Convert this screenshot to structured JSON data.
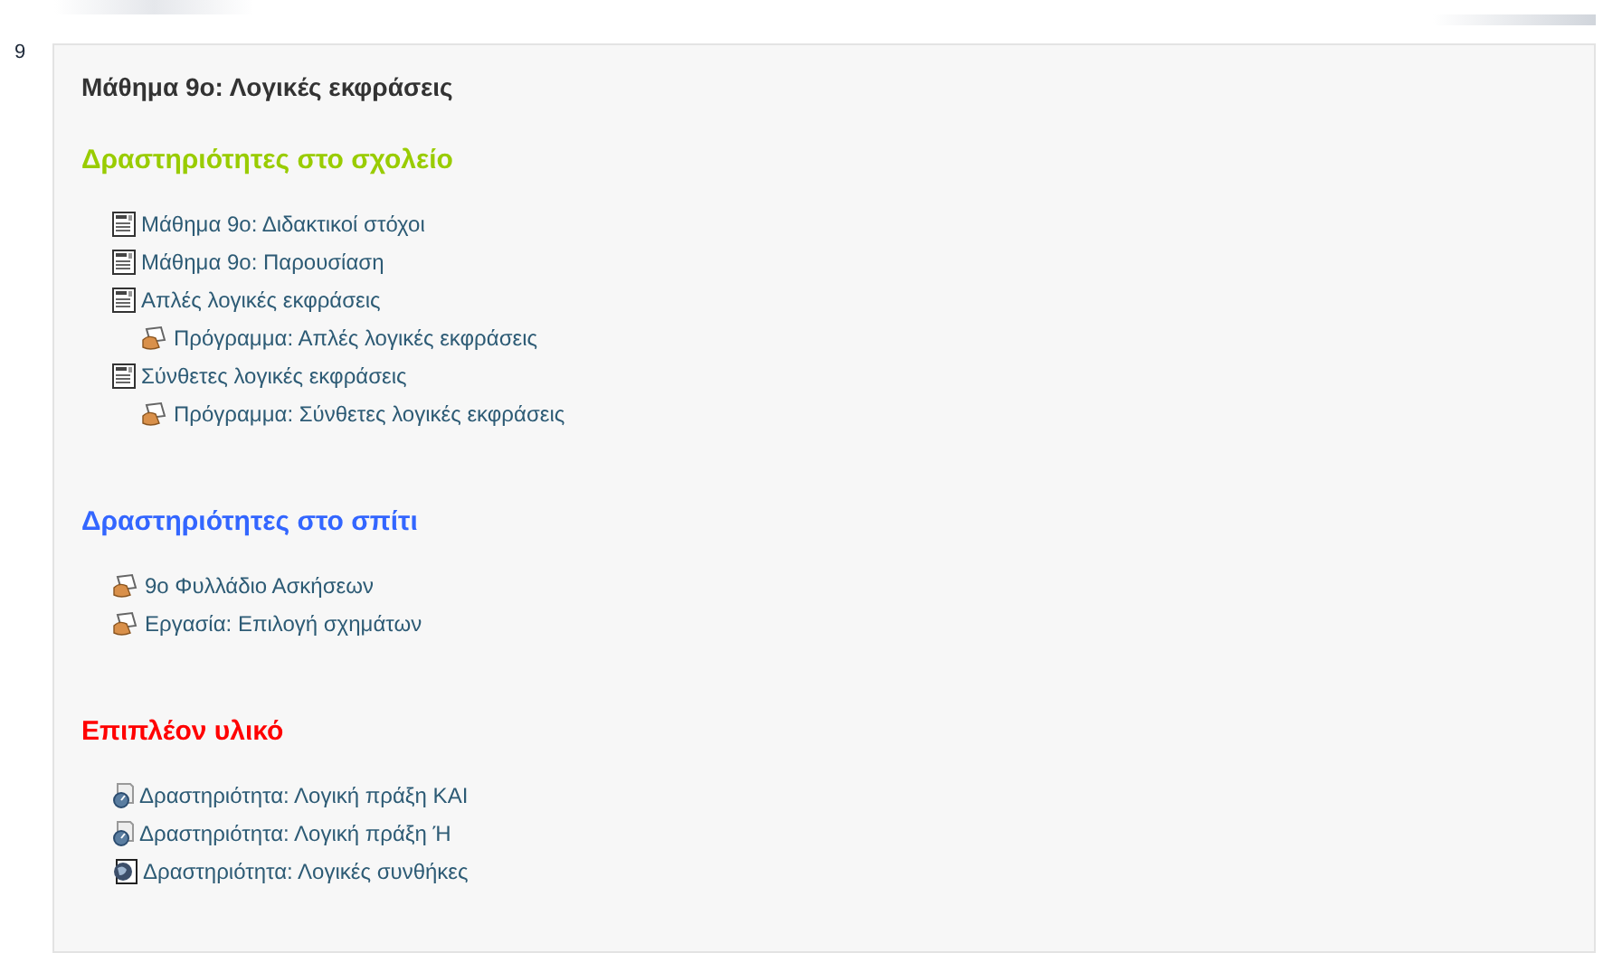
{
  "section_number": "9",
  "title": "Μάθημα 9ο: Λογικές εκφράσεις",
  "groups": [
    {
      "heading": "Δραστηριότητες στο σχολείο",
      "color": "#99cc00",
      "items": [
        {
          "kind": "page",
          "label": "Μάθημα 9ο: Διδακτικοί στόχοι"
        },
        {
          "kind": "page",
          "label": "Μάθημα 9ο: Παρουσίαση"
        },
        {
          "kind": "page",
          "label": "Απλές λογικές εκφράσεις",
          "children": [
            {
              "kind": "assignment",
              "label": "Πρόγραμμα: Απλές λογικές εκφράσεις"
            }
          ]
        },
        {
          "kind": "page",
          "label": "Σύνθετες λογικές εκφράσεις",
          "children": [
            {
              "kind": "assignment",
              "label": "Πρόγραμμα: Σύνθετες λογικές εκφράσεις"
            }
          ]
        }
      ]
    },
    {
      "heading": "Δραστηριότητες στο σπίτι",
      "color": "#3366ff",
      "items": [
        {
          "kind": "assignment",
          "label": "9ο Φυλλάδιο Ασκήσεων"
        },
        {
          "kind": "assignment",
          "label": "Εργασία: Επιλογή σχημάτων"
        }
      ]
    },
    {
      "heading": "Επιπλέον υλικό",
      "color": "#ff0000",
      "items": [
        {
          "kind": "link",
          "label": "Δραστηριότητα: Λογική πράξη ΚΑΙ"
        },
        {
          "kind": "link",
          "label": "Δραστηριότητα: Λογική πράξη Ή"
        },
        {
          "kind": "globe",
          "label": "Δραστηριότητα: Λογικές συνθήκες"
        }
      ]
    }
  ]
}
